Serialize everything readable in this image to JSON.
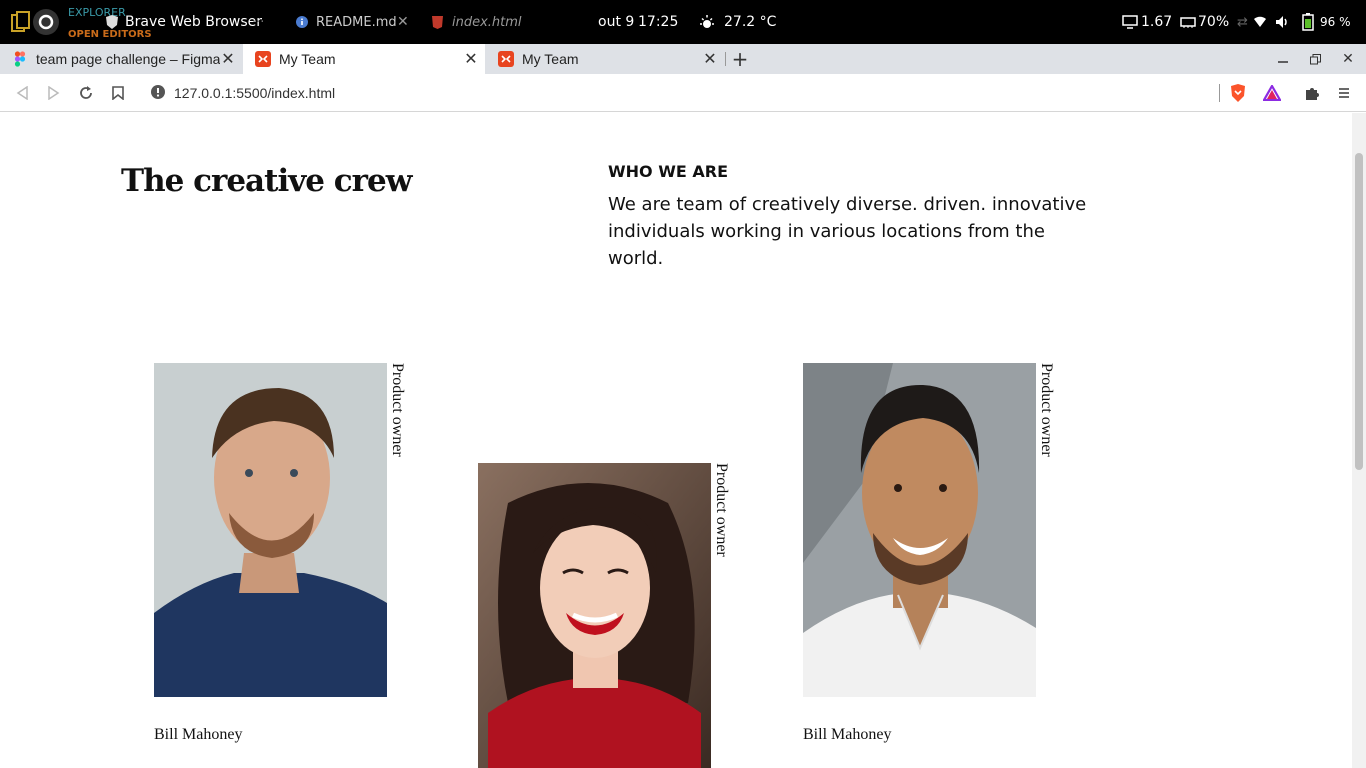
{
  "os_bar": {
    "activities_icon": "circle-icon",
    "ghost_explorer": "EXPLORER",
    "ghost_open_editors": "OPEN EDITORS",
    "app_name": "Brave Web Browser",
    "app_menu": "···",
    "editor_tab_readme": "README.md",
    "editor_tab_index": "index.html",
    "date": "out 9",
    "time": "17:25",
    "weather": "27.2 °C",
    "cpu_load": "1.67",
    "memory": "70%",
    "battery": "96 %"
  },
  "browser": {
    "tabs": [
      {
        "label": "team page challenge – Figma",
        "favicon": "figma-icon"
      },
      {
        "label": "My Team",
        "favicon": "html-icon"
      },
      {
        "label": "My Team",
        "favicon": "html-icon"
      }
    ],
    "url": "127.0.0.1:5500/index.html"
  },
  "page": {
    "title": "The creative crew",
    "who_heading": "WHO WE ARE",
    "who_text": "We are team of creatively diverse. driven. innovative individuals working in various locations from the world.",
    "members": [
      {
        "role": "Product owner",
        "name": "Bill Mahoney"
      },
      {
        "role": "Product owner",
        "name": ""
      },
      {
        "role": "Product owner",
        "name": "Bill Mahoney"
      }
    ]
  },
  "colors": {
    "os_bar_bg": "#000000",
    "tabstrip_bg": "#dee1e6",
    "accent_red": "#e8441f",
    "brave_orange": "#fb542b"
  }
}
